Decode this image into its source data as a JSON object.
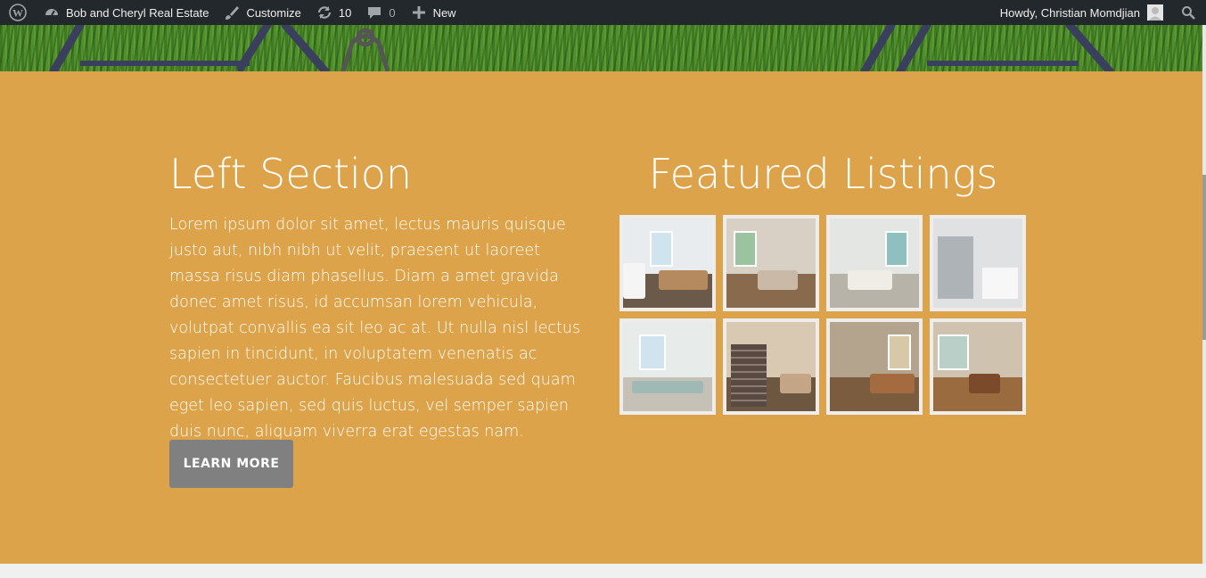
{
  "adminbar": {
    "site_name": "Bob and Cheryl Real Estate",
    "customize": "Customize",
    "updates_count": "10",
    "comments_count": "0",
    "new_label": "New",
    "greeting": "Howdy, Christian Momdjian"
  },
  "left": {
    "title": "Left Section",
    "body": "Lorem ipsum dolor sit amet, lectus mauris quisque justo aut, nibh nibh ut velit, praesent ut laoreet massa risus diam phasellus. Diam a amet gravida donec amet risus, id accumsan lorem vehicula, volutpat convallis ea sit leo ac at. Ut nulla nisl lectus sapien in tincidunt, in voluptatem venenatis ac consectetuer auctor. Faucibus malesuada sed quam eget leo sapien, sed quis luctus, vel semper sapien duis nunc, aliquam viverra erat egestas nam.",
    "button": "LEARN MORE"
  },
  "right": {
    "title": "Featured Listings"
  },
  "colors": {
    "section_bg": "#dca34a",
    "adminbar_bg": "#23282d",
    "button_bg": "#808080"
  }
}
